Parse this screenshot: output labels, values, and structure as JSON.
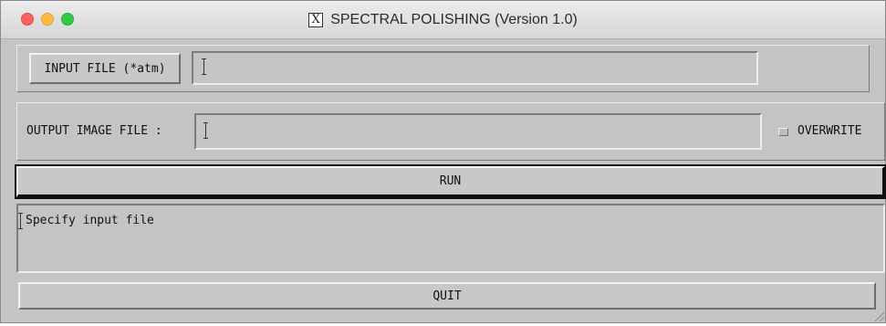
{
  "window": {
    "title": "SPECTRAL POLISHING (Version 1.0)",
    "title_icon": "x11-icon"
  },
  "input": {
    "button_label": "INPUT FILE (*atm)",
    "value": ""
  },
  "output": {
    "label": "OUTPUT IMAGE FILE :",
    "value": "",
    "overwrite_label": "OVERWRITE",
    "overwrite_checked": false
  },
  "run": {
    "label": "RUN"
  },
  "message": {
    "text": "Specify input file"
  },
  "quit": {
    "label": "QUIT"
  }
}
